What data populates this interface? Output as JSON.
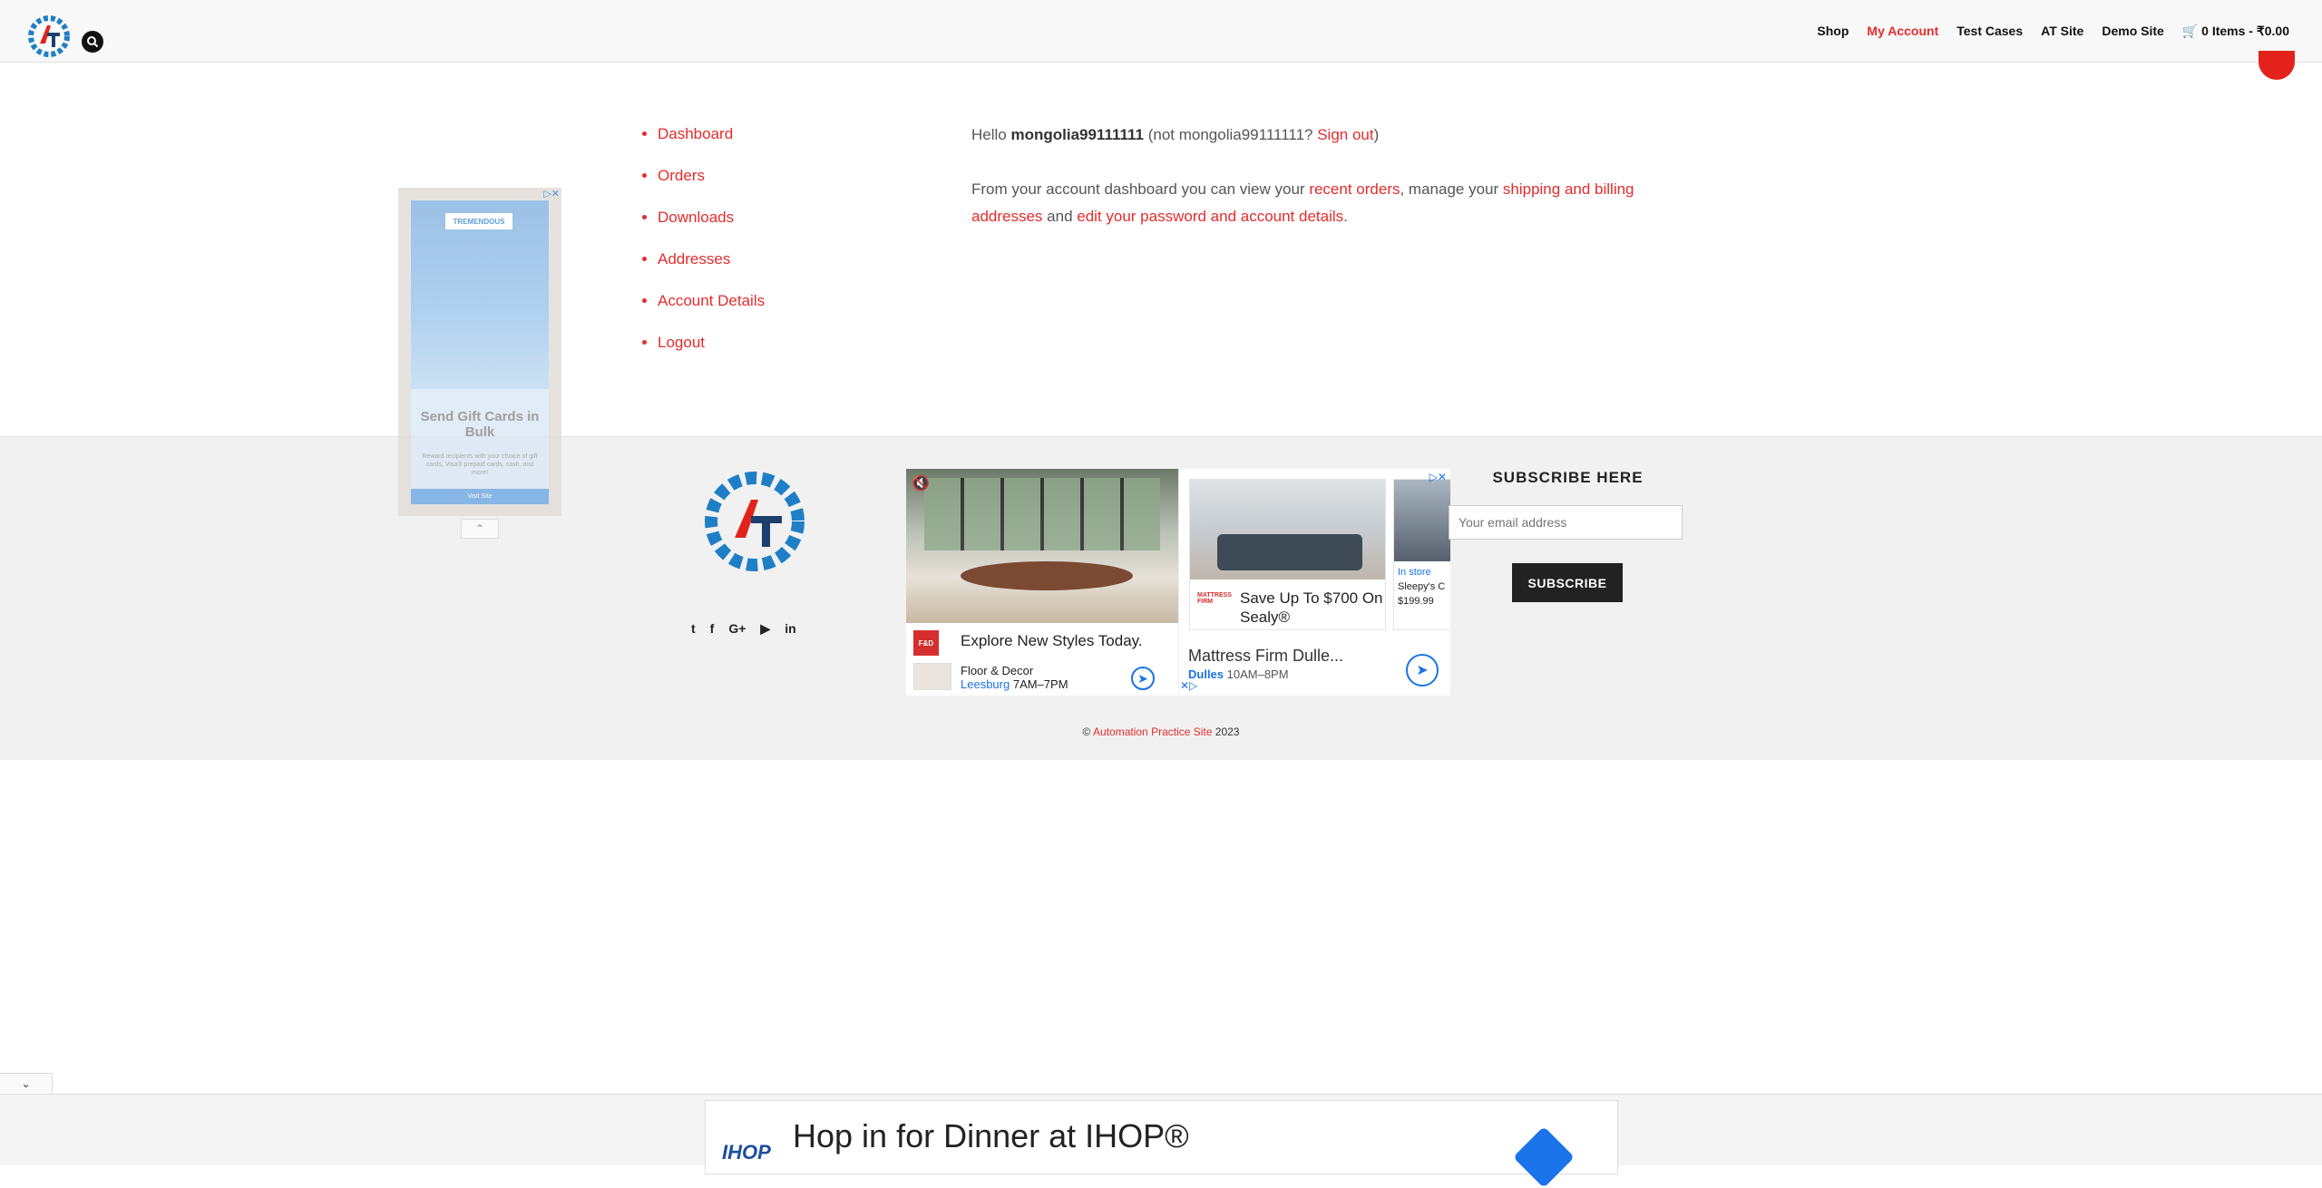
{
  "header": {
    "nav": [
      {
        "label": "Shop",
        "active": false
      },
      {
        "label": "My Account",
        "active": true
      },
      {
        "label": "Test Cases",
        "active": false
      },
      {
        "label": "AT Site",
        "active": false
      },
      {
        "label": "Demo Site",
        "active": false
      }
    ],
    "cart": "0 Items - ₹0.00"
  },
  "account_menu": [
    "Dashboard",
    "Orders",
    "Downloads",
    "Addresses",
    "Account Details",
    "Logout"
  ],
  "greeting": {
    "hello": "Hello ",
    "username": "mongolia99111111",
    "not_prefix": " (not mongolia99111111? ",
    "sign_out": "Sign out",
    "close_paren": ")"
  },
  "dashboard_text": {
    "part1": "From your account dashboard you can view your ",
    "recent_orders": "recent orders",
    "part2": ", manage your ",
    "addresses_link": "shipping and billing addresses",
    "part3": " and ",
    "password_link": "edit your password and account details",
    "part4": "."
  },
  "footer": {
    "subscribe_title": "SUBSCRIBE HERE",
    "email_placeholder": "Your email address",
    "subscribe_button": "SUBSCRIBE",
    "copyright_symbol": "© ",
    "copyright_link": "Automation Practice Site",
    "copyright_year": " 2023",
    "socials": [
      "twitter-icon",
      "facebook-icon",
      "google-plus-icon",
      "youtube-icon",
      "linkedin-icon"
    ]
  },
  "ad_center": {
    "left_headline": "Explore New Styles Today.",
    "left_store": "Floor & Decor",
    "left_location": "Leesburg",
    "left_hours": "7AM–7PM",
    "card_title": "Save Up To $700 On Sealy®",
    "card2_badge": "In store",
    "card2_name": "Sleepy's C",
    "card2_price": "$199.99",
    "right_store": "Mattress Firm Dulle...",
    "right_location": "Dulles",
    "right_hours": "10AM–8PM"
  },
  "float_ad": {
    "tag": "TREMENDOUS",
    "title": "Send Gift Cards in Bulk",
    "description": "Reward recipients with your choice of gift cards, Visa® prepaid cards, cash, and more!",
    "cta": "Visit Site"
  },
  "bottom_ad": {
    "brand": "IHOP",
    "headline": "Hop in for Dinner at IHOP®"
  },
  "colors": {
    "accent": "#e42c2c",
    "dark": "#222222",
    "link_blue": "#1a73e8"
  }
}
